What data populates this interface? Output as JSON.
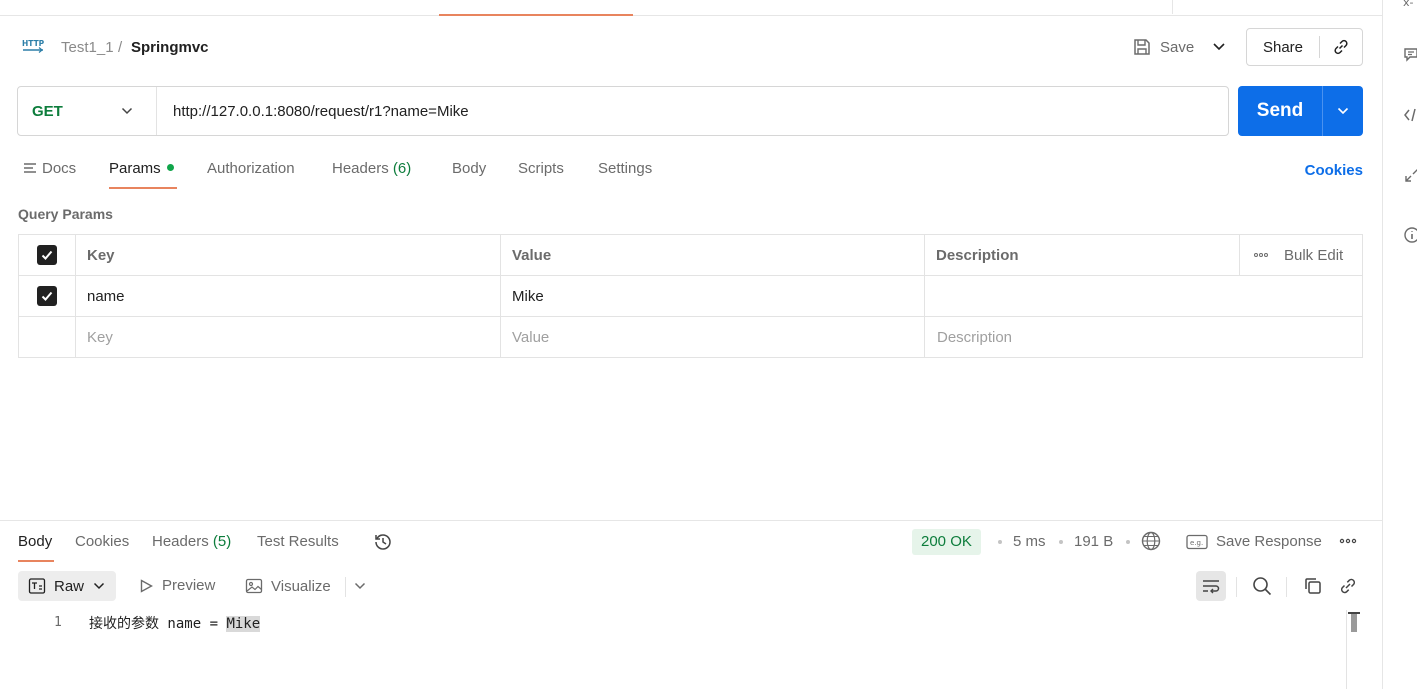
{
  "breadcrumb": {
    "parent": "Test1_1",
    "separator": "/",
    "current": "Springmvc"
  },
  "header_actions": {
    "save_label": "Save",
    "share_label": "Share"
  },
  "request": {
    "method": "GET",
    "url": "http://127.0.0.1:8080/request/r1?name=Mike",
    "send_label": "Send"
  },
  "request_tabs": {
    "docs": "Docs",
    "params": "Params",
    "authorization": "Authorization",
    "headers": "Headers",
    "headers_count": "(6)",
    "body": "Body",
    "scripts": "Scripts",
    "settings": "Settings",
    "cookies": "Cookies"
  },
  "query_params": {
    "title": "Query Params",
    "columns": {
      "key": "Key",
      "value": "Value",
      "description": "Description",
      "bulk_edit": "Bulk Edit"
    },
    "rows": [
      {
        "key": "name",
        "value": "Mike",
        "description": "",
        "enabled": true
      }
    ],
    "placeholders": {
      "key": "Key",
      "value": "Value",
      "description": "Description"
    }
  },
  "response_tabs": {
    "body": "Body",
    "cookies": "Cookies",
    "headers": "Headers",
    "headers_count": "(5)",
    "test_results": "Test Results"
  },
  "response_meta": {
    "status": "200 OK",
    "time": "5 ms",
    "size": "191 B",
    "save_response": "Save Response"
  },
  "response_toolbar": {
    "format": "Raw",
    "preview": "Preview",
    "visualize": "Visualize"
  },
  "response_body": {
    "line_number": "1",
    "text_prefix": "接收的参数 name = ",
    "text_highlight": "Mike"
  },
  "colors": {
    "accent": "#0d6ee8",
    "method_get": "#0d7d3c",
    "active_tab_underline": "#e8845e",
    "status_bg": "#e6f4ea"
  }
}
